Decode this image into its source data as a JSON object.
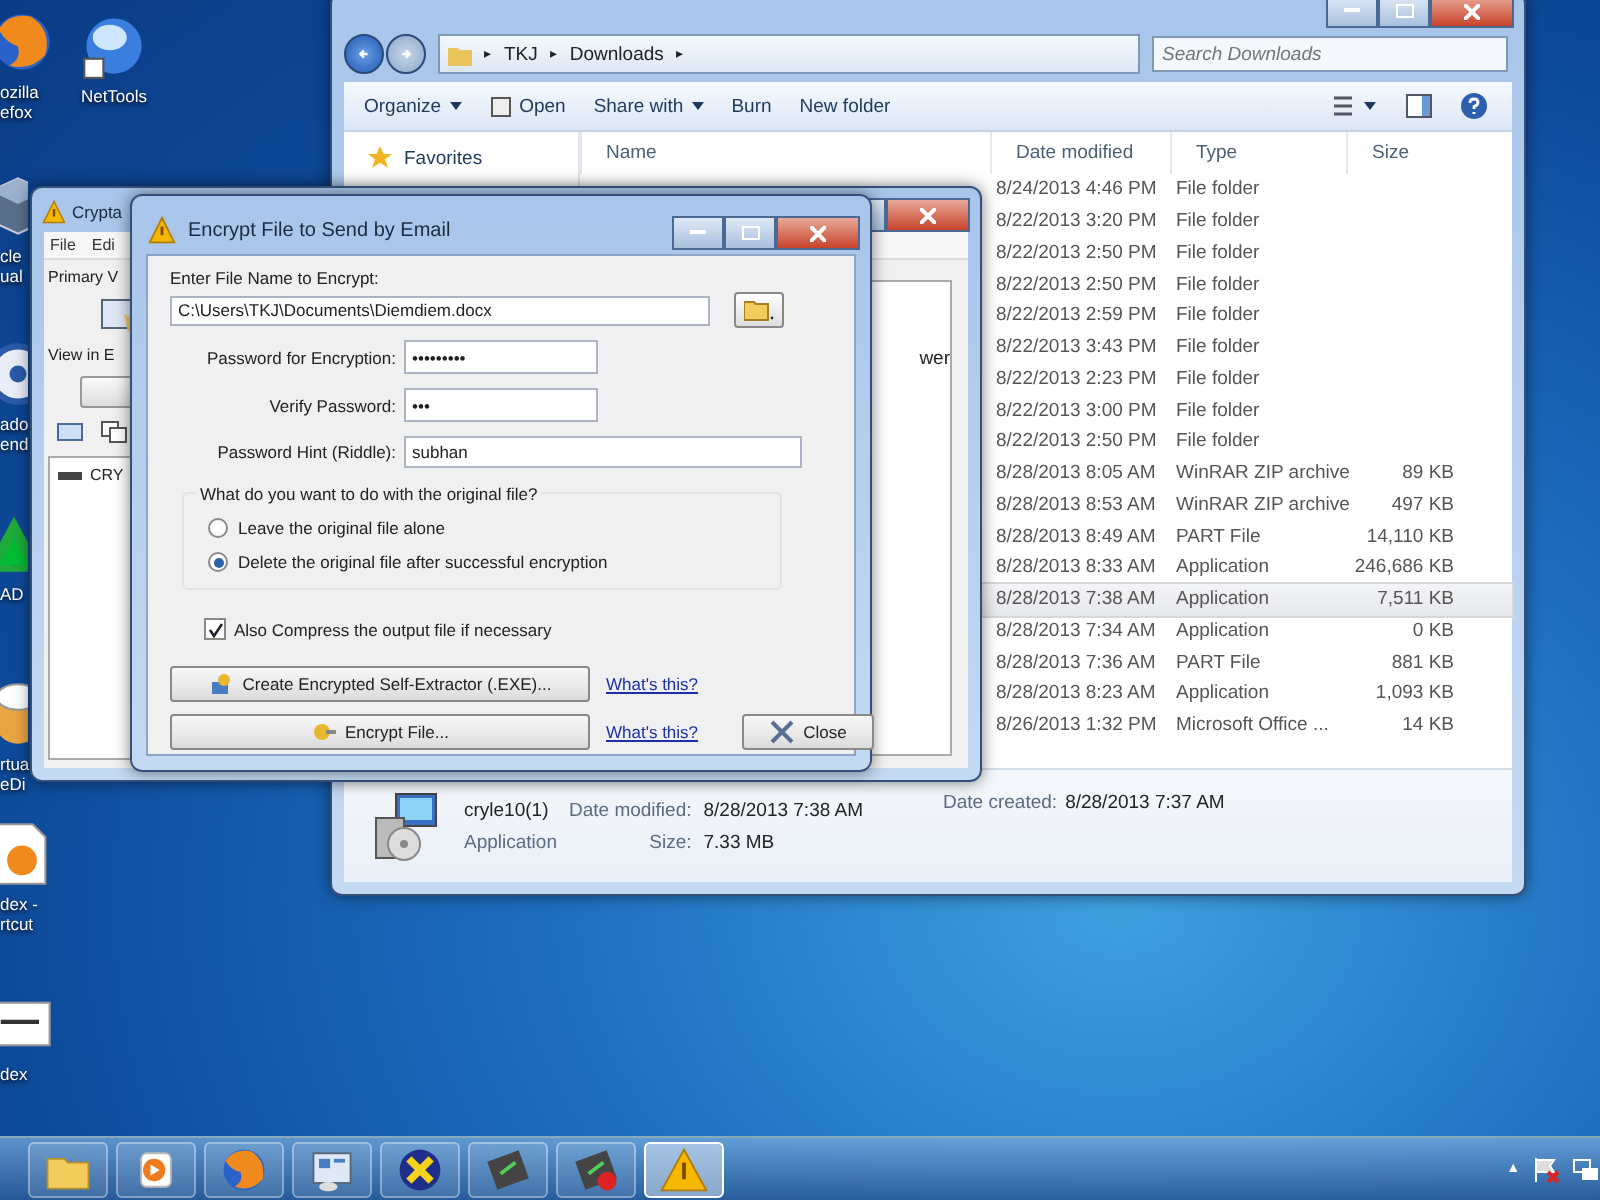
{
  "desktop_icons": [
    {
      "kind": "browser",
      "lines": [
        "ozilla",
        "efox"
      ]
    },
    {
      "kind": "globe",
      "lines": [
        "NetTools"
      ]
    },
    {
      "kind": "cube",
      "lines": [
        "cle",
        "ual"
      ]
    },
    {
      "kind": "disc",
      "lines": [
        "ado",
        "end"
      ]
    },
    {
      "kind": "triangle",
      "lines": [
        "AD"
      ]
    },
    {
      "kind": "chef",
      "lines": [
        "rtua",
        "eDi"
      ]
    },
    {
      "kind": "document",
      "lines": [
        "dex -",
        "rtcut"
      ]
    },
    {
      "kind": "sheet",
      "lines": [
        "dex"
      ]
    }
  ],
  "explorer": {
    "breadcrumb": [
      {
        "kind": "separator",
        "text": "▸"
      },
      {
        "kind": "crumb",
        "text": "TKJ"
      },
      {
        "kind": "separator",
        "text": "▸"
      },
      {
        "kind": "crumb",
        "text": "Downloads"
      },
      {
        "kind": "separator",
        "text": "▸"
      }
    ],
    "search": {
      "placeholder": "Search Downloads"
    },
    "toolbar": [
      {
        "label": "Organize",
        "dropdown": true,
        "has_icon": false
      },
      {
        "label": "Open",
        "dropdown": false,
        "has_icon": true
      },
      {
        "label": "Share with",
        "dropdown": true,
        "has_icon": false
      },
      {
        "label": "Burn",
        "dropdown": false,
        "has_icon": false
      },
      {
        "label": "New folder",
        "dropdown": false,
        "has_icon": false
      }
    ],
    "nav": [
      "Favorites"
    ],
    "columns": [
      "Name",
      "Date modified",
      "Type",
      "Size"
    ],
    "rows": [
      {
        "date": "8/24/2013 4:46 PM",
        "type": "File folder",
        "size": "",
        "selected": false
      },
      {
        "date": "8/22/2013 3:20 PM",
        "type": "File folder",
        "size": "",
        "selected": false
      },
      {
        "date": "8/22/2013 2:50 PM",
        "type": "File folder",
        "size": "",
        "selected": false
      },
      {
        "date": "8/22/2013 2:50 PM",
        "type": "File folder",
        "size": "",
        "selected": false
      },
      {
        "date": "8/22/2013 2:59 PM",
        "type": "File folder",
        "size": "",
        "selected": false
      },
      {
        "date": "8/22/2013 3:43 PM",
        "type": "File folder",
        "size": "",
        "selected": false
      },
      {
        "date": "8/22/2013 2:23 PM",
        "type": "File folder",
        "size": "",
        "selected": false
      },
      {
        "date": "8/22/2013 3:00 PM",
        "type": "File folder",
        "size": "",
        "selected": false
      },
      {
        "date": "8/22/2013 2:50 PM",
        "type": "File folder",
        "size": "",
        "selected": false
      },
      {
        "date": "8/28/2013 8:05 AM",
        "type": "WinRAR ZIP archive",
        "size": "89 KB",
        "selected": false
      },
      {
        "date": "8/28/2013 8:53 AM",
        "type": "WinRAR ZIP archive",
        "size": "497 KB",
        "selected": false
      },
      {
        "date": "8/28/2013 8:49 AM",
        "type": "PART File",
        "size": "14,110 KB",
        "selected": false
      },
      {
        "date": "8/28/2013 8:33 AM",
        "type": "Application",
        "size": "246,686 KB",
        "selected": false
      },
      {
        "date": "8/28/2013 7:38 AM",
        "type": "Application",
        "size": "7,511 KB",
        "selected": true
      },
      {
        "date": "8/28/2013 7:34 AM",
        "type": "Application",
        "size": "0 KB",
        "selected": false
      },
      {
        "date": "8/28/2013 7:36 AM",
        "type": "PART File",
        "size": "881 KB",
        "selected": false
      },
      {
        "date": "8/28/2013 8:23 AM",
        "type": "Application",
        "size": "1,093 KB",
        "selected": false
      },
      {
        "date": "8/26/2013 1:32 PM",
        "type": "Microsoft Office ...",
        "size": "14 KB",
        "selected": false
      }
    ],
    "details": {
      "name": "cryle10(1)",
      "kind": "Application",
      "modified_label": "Date modified:",
      "modified": "8/28/2013 7:38 AM",
      "size_label": "Size:",
      "size": "7.33 MB",
      "created_label": "Date created:",
      "created": "8/28/2013 7:37 AM"
    }
  },
  "cryptainer": {
    "title": "Crypta",
    "menu": [
      "File",
      "Edi"
    ],
    "volume_label": "Primary V",
    "view_label": "View in E",
    "tree_item": "CRY",
    "side_text": "wer"
  },
  "dialog": {
    "title": "Encrypt File to Send by Email",
    "file_label": "Enter File Name to Encrypt:",
    "file_path": "C:\\Users\\TKJ\\Documents\\Diemdiem.docx",
    "fields": [
      {
        "label": "Password for Encryption:",
        "value": "•••••••••",
        "kind": "short"
      },
      {
        "label": "Verify Password:",
        "value": "•••",
        "kind": "short"
      },
      {
        "label": "Password Hint (Riddle):",
        "value": "subhan",
        "kind": "long"
      }
    ],
    "group": {
      "question": "What do you want to do with the original file?",
      "options": [
        {
          "label": "Leave the original file alone",
          "selected": false
        },
        {
          "label": "Delete the original file after successful encryption",
          "selected": true
        }
      ]
    },
    "compress": {
      "label": "Also Compress the output file if necessary",
      "checked": true
    },
    "actions": [
      {
        "label": "Create Encrypted Self-Extractor (.EXE)...",
        "link": "What's this?"
      },
      {
        "label": "Encrypt File...",
        "link": "What's this?"
      }
    ],
    "close": "Close"
  },
  "taskbar": [
    {
      "kind": "folder",
      "active": false
    },
    {
      "kind": "media",
      "active": false
    },
    {
      "kind": "browser",
      "active": false
    },
    {
      "kind": "panel",
      "active": false
    },
    {
      "kind": "cross",
      "active": false
    },
    {
      "kind": "green",
      "active": false
    },
    {
      "kind": "greenred",
      "active": false
    },
    {
      "kind": "warning",
      "active": true
    }
  ],
  "tray": {
    "arrow": "▲"
  }
}
